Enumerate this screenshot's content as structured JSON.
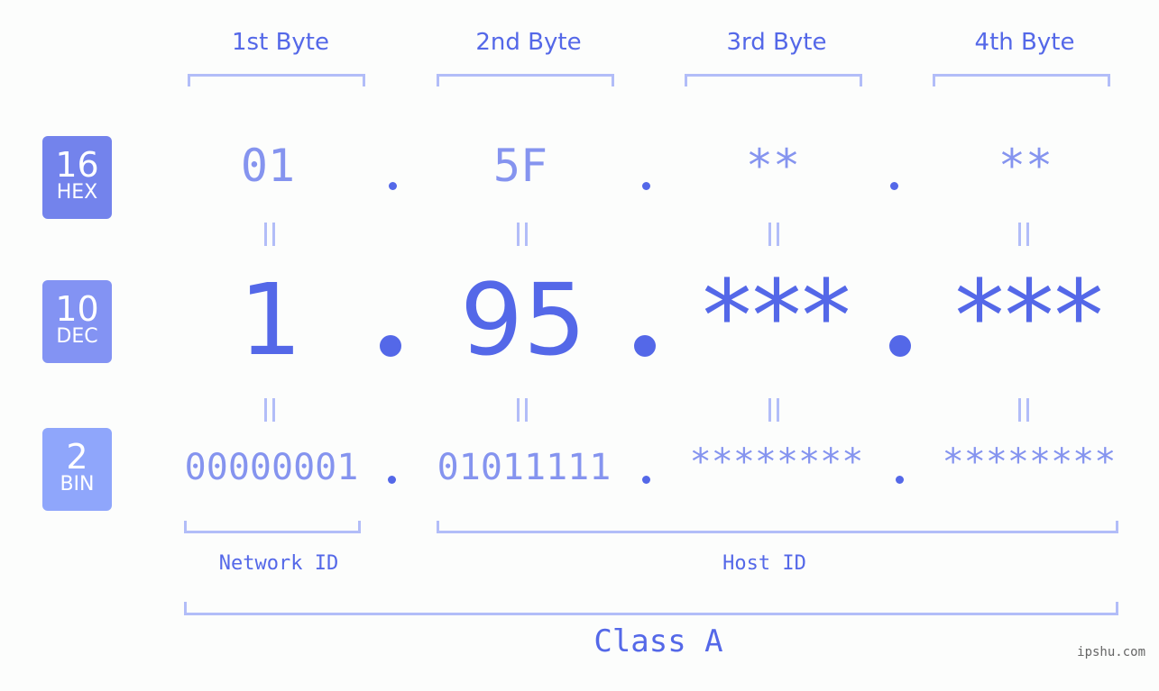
{
  "header": {
    "bytes": [
      {
        "label": "1st Byte"
      },
      {
        "label": "2nd Byte"
      },
      {
        "label": "3rd Byte"
      },
      {
        "label": "4th Byte"
      }
    ]
  },
  "rows": {
    "hex": {
      "base": "16",
      "name": "HEX",
      "color": "#7383ec",
      "values": [
        "01",
        "5F",
        "**",
        "**"
      ]
    },
    "dec": {
      "base": "10",
      "name": "DEC",
      "color": "#8393f3",
      "values": [
        "1",
        "95",
        "***",
        "***"
      ]
    },
    "bin": {
      "base": "2",
      "name": "BIN",
      "color": "#8fa6fb",
      "values": [
        "00000001",
        "01011111",
        "********",
        "********"
      ]
    }
  },
  "separator": ".",
  "segments": {
    "network": "Network ID",
    "host": "Host ID",
    "class": "Class A"
  },
  "watermark": "ipshu.com",
  "colors": {
    "accent": "#5468e8",
    "muted": "#8594ef",
    "bracket": "#b2bdf8"
  }
}
